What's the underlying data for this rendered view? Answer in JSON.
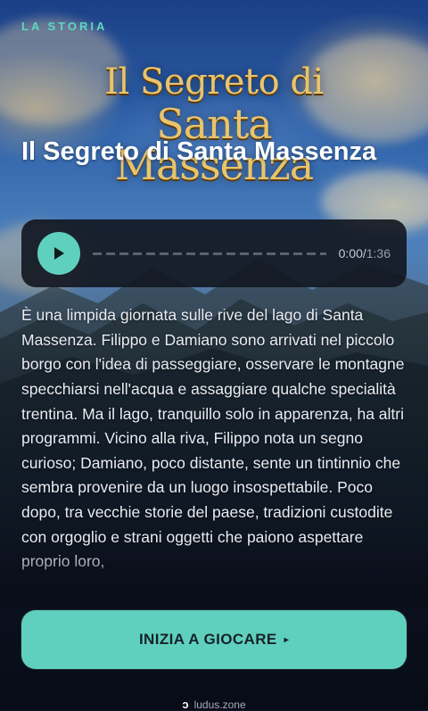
{
  "eyebrow": "LA STORIA",
  "logo": {
    "line1": "Il Segreto di",
    "line2": "Santa Massenza"
  },
  "title": "Il Segreto di Santa Massenza",
  "player": {
    "current_time": "0:00",
    "separator": "/",
    "total_time": "1:36",
    "progress": 0
  },
  "story": "È una limpida giornata sulle rive del lago di Santa Massenza. Filippo e Damiano sono arrivati nel piccolo borgo con l'idea di passeggiare, osservare le montagne specchiarsi nell'acqua e assaggiare qualche specialità trentina. Ma il lago, tranquillo solo in apparenza, ha altri programmi. Vicino alla riva, Filippo nota un segno curioso; Damiano, poco distante, sente un tintinnio che sembra provenire da un luogo insospettabile. Poco dopo, tra vecchie storie del paese, tradizioni custodite con orgoglio e strani oggetti che paiono aspettare proprio loro,",
  "cta": {
    "label": "INIZIA A GIOCARE",
    "arrow": "▸"
  },
  "footer": {
    "brand": "ludus.zone"
  },
  "colors": {
    "accent": "#5fd0bd",
    "eyebrow": "#5fd6c2",
    "logo_gold": "#e9c46a"
  }
}
